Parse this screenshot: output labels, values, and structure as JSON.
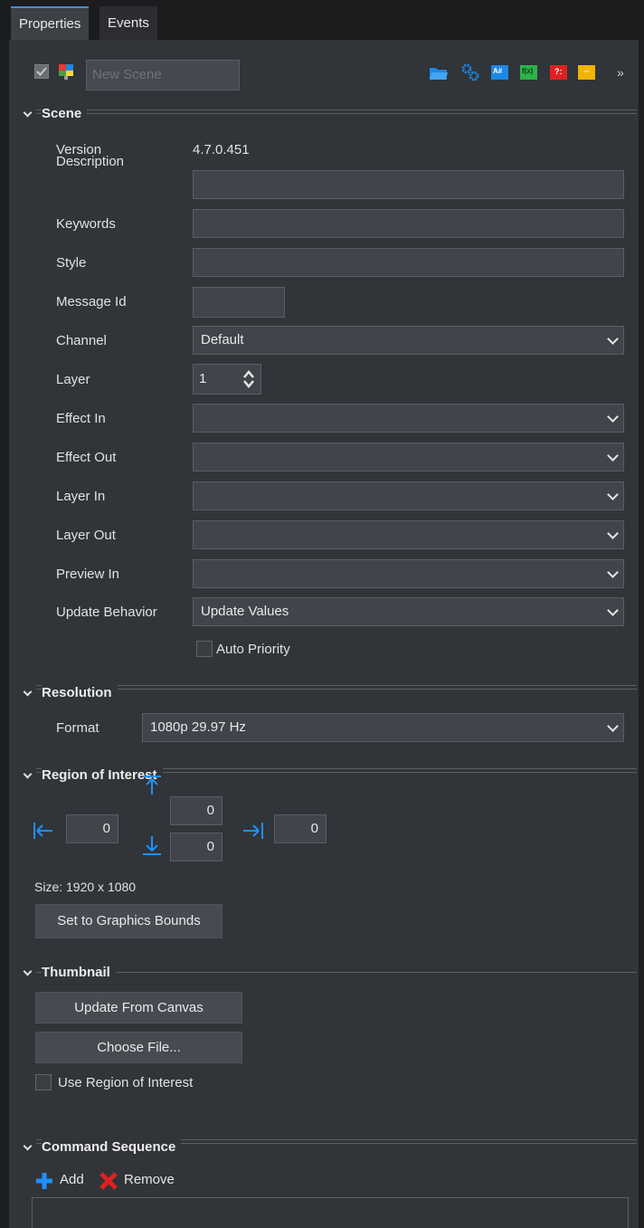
{
  "tabs": [
    {
      "label": "Properties",
      "active": true
    },
    {
      "label": "Events",
      "active": false
    }
  ],
  "toolbar": {
    "name_placeholder": "New Scene",
    "icons": [
      "folder-icon",
      "gears-icon",
      "ab-icon",
      "function-icon",
      "question-icon",
      "link-icon"
    ],
    "overflow": "»"
  },
  "scene": {
    "title": "Scene",
    "version_label": "Version",
    "version_value": "4.7.0.451",
    "description_label": "Description",
    "description_value": "",
    "keywords_label": "Keywords",
    "keywords_value": "",
    "style_label": "Style",
    "style_value": "",
    "message_id_label": "Message Id",
    "message_id_value": "",
    "channel_label": "Channel",
    "channel_value": "Default",
    "layer_label": "Layer",
    "layer_value": "1",
    "effect_in_label": "Effect In",
    "effect_in_value": "",
    "effect_out_label": "Effect Out",
    "effect_out_value": "",
    "layer_in_label": "Layer In",
    "layer_in_value": "",
    "layer_out_label": "Layer Out",
    "layer_out_value": "",
    "preview_in_label": "Preview In",
    "preview_in_value": "",
    "update_behavior_label": "Update Behavior",
    "update_behavior_value": "Update Values",
    "auto_priority_label": "Auto Priority",
    "auto_priority_checked": false
  },
  "resolution": {
    "title": "Resolution",
    "format_label": "Format",
    "format_value": "1080p 29.97 Hz"
  },
  "roi": {
    "title": "Region of Interest",
    "left": "0",
    "top": "0",
    "bottom": "0",
    "right": "0",
    "size_text": "Size: 1920 x 1080",
    "set_bounds_label": "Set to Graphics Bounds"
  },
  "thumbnail": {
    "title": "Thumbnail",
    "update_label": "Update From Canvas",
    "choose_label": "Choose File...",
    "use_roi_label": "Use Region of Interest",
    "use_roi_checked": false
  },
  "command_sequence": {
    "title": "Command Sequence",
    "add_label": "Add",
    "remove_label": "Remove"
  },
  "colors": {
    "panel": "#313438",
    "field": "#41444a",
    "accent_blue": "#1e90ff",
    "remove_red": "#e02020"
  }
}
